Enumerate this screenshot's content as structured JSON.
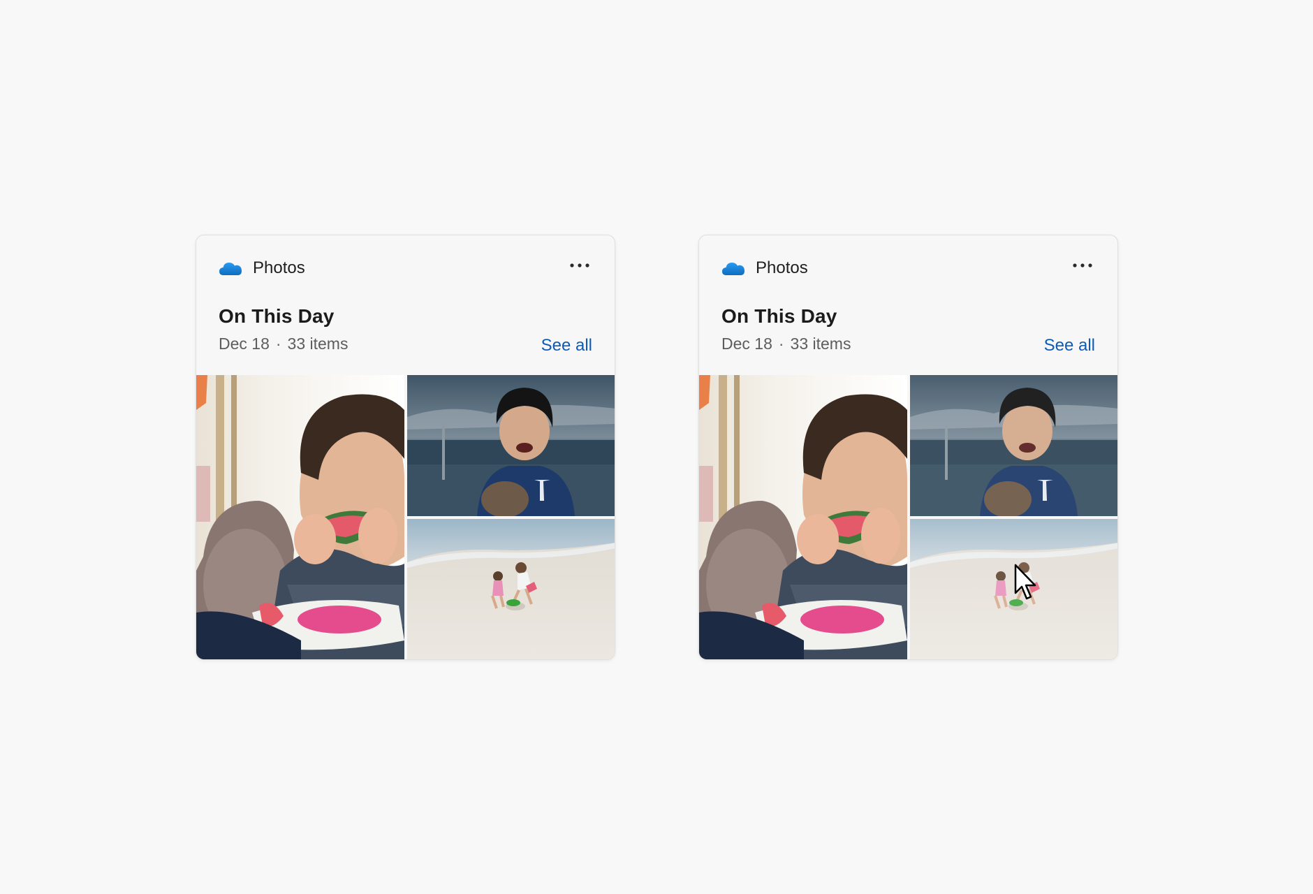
{
  "cards": [
    {
      "state": "default",
      "app_name": "Photos",
      "app_icon": "onedrive-cloud-icon",
      "more_icon": "more-options-icon",
      "title": "On This Day",
      "date": "Dec 18",
      "separator": "·",
      "count": "33 items",
      "see_all_label": "See all",
      "photos": [
        "boy-eating-watermelon",
        "boy-laughing-balcony",
        "children-on-beach"
      ]
    },
    {
      "state": "hover",
      "app_name": "Photos",
      "app_icon": "onedrive-cloud-icon",
      "more_icon": "more-options-icon",
      "title": "On This Day",
      "date": "Dec 18",
      "separator": "·",
      "count": "33 items",
      "see_all_label": "See all",
      "photos": [
        "boy-eating-watermelon",
        "boy-laughing-balcony",
        "children-on-beach"
      ]
    }
  ],
  "colors": {
    "background": "#f8f8f8",
    "card": "#f7f7f7",
    "link": "#0f5bb4",
    "cloud": "#1b86d6"
  },
  "cursor_icon": "arrow-pointer-icon"
}
